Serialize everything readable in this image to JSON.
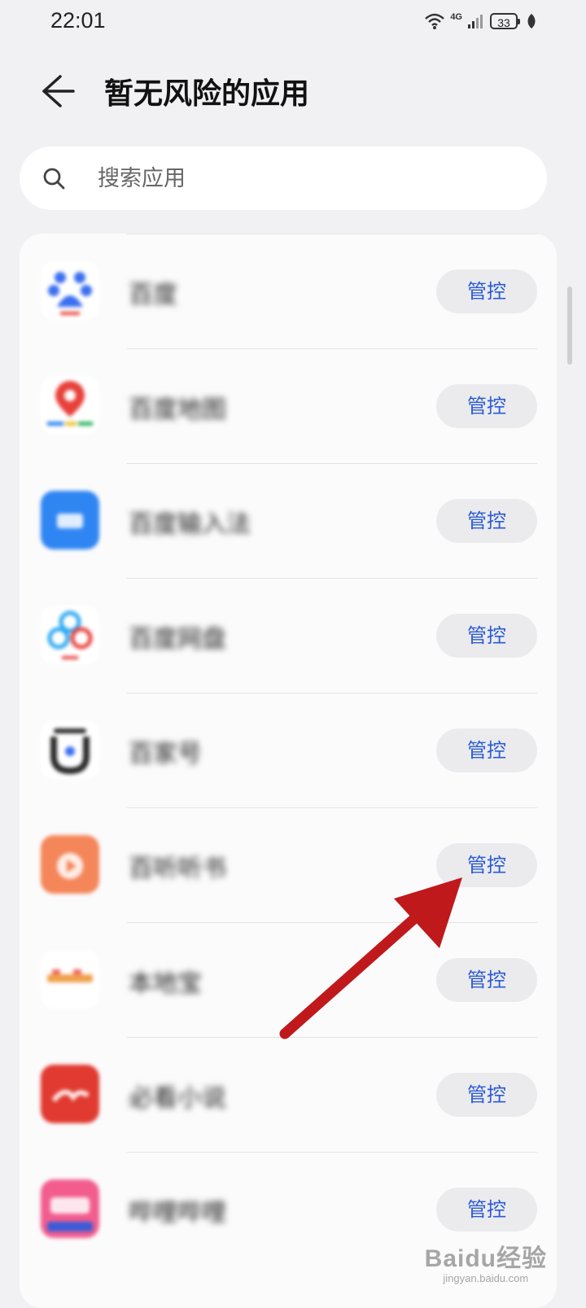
{
  "status_bar": {
    "time": "22:01",
    "network": "4G",
    "battery": "33",
    "icons": [
      "wifi-icon",
      "signal-icon",
      "battery-icon",
      "leaf-icon"
    ]
  },
  "header": {
    "title": "暂无风险的应用",
    "back_icon": "back-arrow-icon"
  },
  "search": {
    "placeholder": "搜索应用",
    "icon": "search-icon"
  },
  "apps": [
    {
      "name": "百度",
      "action": "管控",
      "icon": "baidu-icon",
      "color": "#3b6ff0"
    },
    {
      "name": "百度地图",
      "action": "管控",
      "icon": "baidu-map-icon",
      "color": "#e8403b"
    },
    {
      "name": "百度输入法",
      "action": "管控",
      "icon": "baidu-input-icon",
      "color": "#2f86f3"
    },
    {
      "name": "百度网盘",
      "action": "管控",
      "icon": "baidu-netdisk-icon",
      "color": "#29a7f0"
    },
    {
      "name": "百家号",
      "action": "管控",
      "icon": "baijiahao-icon",
      "color": "#2b2b2b"
    },
    {
      "name": "百听听书",
      "action": "管控",
      "icon": "baiting-icon",
      "color": "#f4865a"
    },
    {
      "name": "本地宝",
      "action": "管控",
      "icon": "bendibao-icon",
      "color": "#f0a04a"
    },
    {
      "name": "必看小说",
      "action": "管控",
      "icon": "bikan-icon",
      "color": "#e13a30"
    },
    {
      "name": "哔哩哔哩",
      "action": "管控",
      "icon": "bilibili-icon",
      "color": "#f25d8e"
    }
  ],
  "annotation": {
    "color": "#c0191b"
  },
  "watermark": {
    "logo": "Baidu经验",
    "url": "jingyan.baidu.com"
  }
}
